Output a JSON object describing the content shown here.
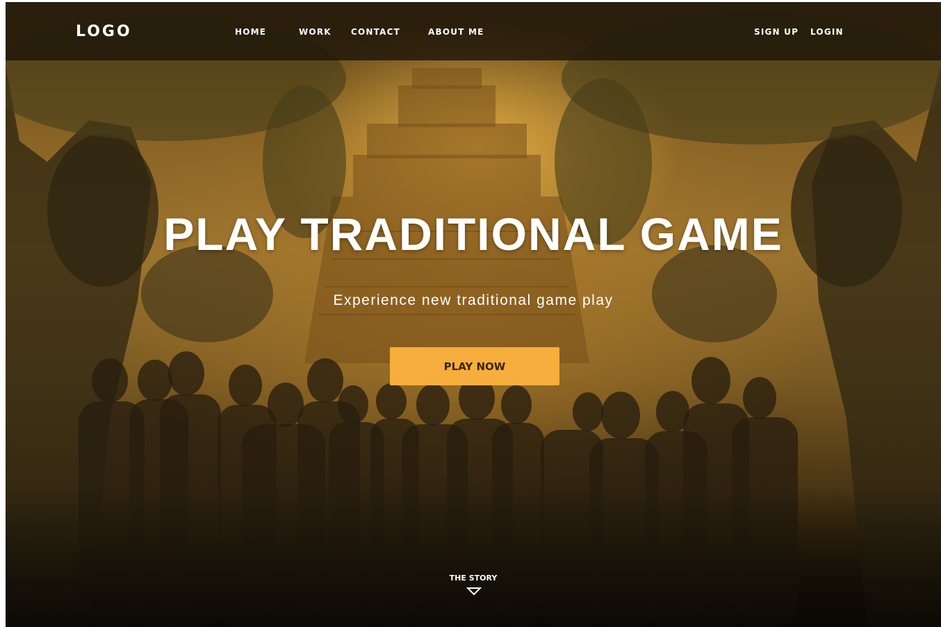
{
  "nav": {
    "logo": "LOGO",
    "links": [
      "HOME",
      "WORK",
      "CONTACT",
      "ABOUT ME"
    ],
    "sign_up": "SIGN UP",
    "login": "LOGIN"
  },
  "hero": {
    "title": "PLAY TRADITIONAL GAME",
    "subtitle": "Experience new traditional game play",
    "cta_label": "PLAY NOW",
    "scroll_label": "THE STORY",
    "scroll_icon": "chevron-down-icon"
  },
  "colors": {
    "cta_background": "#f6ae3c",
    "nav_background": "#1e160a",
    "accent": "#f6ae3c"
  },
  "background_image": "jungle-temple-game-characters"
}
